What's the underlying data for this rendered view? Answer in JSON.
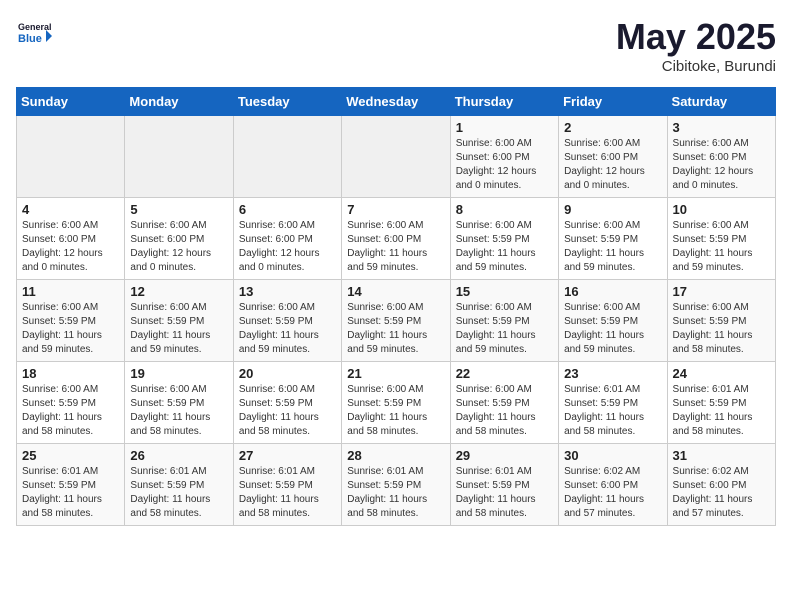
{
  "header": {
    "logo_line1": "General",
    "logo_line2": "Blue",
    "month_title": "May 2025",
    "subtitle": "Cibitoke, Burundi"
  },
  "weekdays": [
    "Sunday",
    "Monday",
    "Tuesday",
    "Wednesday",
    "Thursday",
    "Friday",
    "Saturday"
  ],
  "weeks": [
    [
      {
        "day": "",
        "info": ""
      },
      {
        "day": "",
        "info": ""
      },
      {
        "day": "",
        "info": ""
      },
      {
        "day": "",
        "info": ""
      },
      {
        "day": "1",
        "info": "Sunrise: 6:00 AM\nSunset: 6:00 PM\nDaylight: 12 hours\nand 0 minutes."
      },
      {
        "day": "2",
        "info": "Sunrise: 6:00 AM\nSunset: 6:00 PM\nDaylight: 12 hours\nand 0 minutes."
      },
      {
        "day": "3",
        "info": "Sunrise: 6:00 AM\nSunset: 6:00 PM\nDaylight: 12 hours\nand 0 minutes."
      }
    ],
    [
      {
        "day": "4",
        "info": "Sunrise: 6:00 AM\nSunset: 6:00 PM\nDaylight: 12 hours\nand 0 minutes."
      },
      {
        "day": "5",
        "info": "Sunrise: 6:00 AM\nSunset: 6:00 PM\nDaylight: 12 hours\nand 0 minutes."
      },
      {
        "day": "6",
        "info": "Sunrise: 6:00 AM\nSunset: 6:00 PM\nDaylight: 12 hours\nand 0 minutes."
      },
      {
        "day": "7",
        "info": "Sunrise: 6:00 AM\nSunset: 6:00 PM\nDaylight: 11 hours\nand 59 minutes."
      },
      {
        "day": "8",
        "info": "Sunrise: 6:00 AM\nSunset: 5:59 PM\nDaylight: 11 hours\nand 59 minutes."
      },
      {
        "day": "9",
        "info": "Sunrise: 6:00 AM\nSunset: 5:59 PM\nDaylight: 11 hours\nand 59 minutes."
      },
      {
        "day": "10",
        "info": "Sunrise: 6:00 AM\nSunset: 5:59 PM\nDaylight: 11 hours\nand 59 minutes."
      }
    ],
    [
      {
        "day": "11",
        "info": "Sunrise: 6:00 AM\nSunset: 5:59 PM\nDaylight: 11 hours\nand 59 minutes."
      },
      {
        "day": "12",
        "info": "Sunrise: 6:00 AM\nSunset: 5:59 PM\nDaylight: 11 hours\nand 59 minutes."
      },
      {
        "day": "13",
        "info": "Sunrise: 6:00 AM\nSunset: 5:59 PM\nDaylight: 11 hours\nand 59 minutes."
      },
      {
        "day": "14",
        "info": "Sunrise: 6:00 AM\nSunset: 5:59 PM\nDaylight: 11 hours\nand 59 minutes."
      },
      {
        "day": "15",
        "info": "Sunrise: 6:00 AM\nSunset: 5:59 PM\nDaylight: 11 hours\nand 59 minutes."
      },
      {
        "day": "16",
        "info": "Sunrise: 6:00 AM\nSunset: 5:59 PM\nDaylight: 11 hours\nand 59 minutes."
      },
      {
        "day": "17",
        "info": "Sunrise: 6:00 AM\nSunset: 5:59 PM\nDaylight: 11 hours\nand 58 minutes."
      }
    ],
    [
      {
        "day": "18",
        "info": "Sunrise: 6:00 AM\nSunset: 5:59 PM\nDaylight: 11 hours\nand 58 minutes."
      },
      {
        "day": "19",
        "info": "Sunrise: 6:00 AM\nSunset: 5:59 PM\nDaylight: 11 hours\nand 58 minutes."
      },
      {
        "day": "20",
        "info": "Sunrise: 6:00 AM\nSunset: 5:59 PM\nDaylight: 11 hours\nand 58 minutes."
      },
      {
        "day": "21",
        "info": "Sunrise: 6:00 AM\nSunset: 5:59 PM\nDaylight: 11 hours\nand 58 minutes."
      },
      {
        "day": "22",
        "info": "Sunrise: 6:00 AM\nSunset: 5:59 PM\nDaylight: 11 hours\nand 58 minutes."
      },
      {
        "day": "23",
        "info": "Sunrise: 6:01 AM\nSunset: 5:59 PM\nDaylight: 11 hours\nand 58 minutes."
      },
      {
        "day": "24",
        "info": "Sunrise: 6:01 AM\nSunset: 5:59 PM\nDaylight: 11 hours\nand 58 minutes."
      }
    ],
    [
      {
        "day": "25",
        "info": "Sunrise: 6:01 AM\nSunset: 5:59 PM\nDaylight: 11 hours\nand 58 minutes."
      },
      {
        "day": "26",
        "info": "Sunrise: 6:01 AM\nSunset: 5:59 PM\nDaylight: 11 hours\nand 58 minutes."
      },
      {
        "day": "27",
        "info": "Sunrise: 6:01 AM\nSunset: 5:59 PM\nDaylight: 11 hours\nand 58 minutes."
      },
      {
        "day": "28",
        "info": "Sunrise: 6:01 AM\nSunset: 5:59 PM\nDaylight: 11 hours\nand 58 minutes."
      },
      {
        "day": "29",
        "info": "Sunrise: 6:01 AM\nSunset: 5:59 PM\nDaylight: 11 hours\nand 58 minutes."
      },
      {
        "day": "30",
        "info": "Sunrise: 6:02 AM\nSunset: 6:00 PM\nDaylight: 11 hours\nand 57 minutes."
      },
      {
        "day": "31",
        "info": "Sunrise: 6:02 AM\nSunset: 6:00 PM\nDaylight: 11 hours\nand 57 minutes."
      }
    ]
  ]
}
